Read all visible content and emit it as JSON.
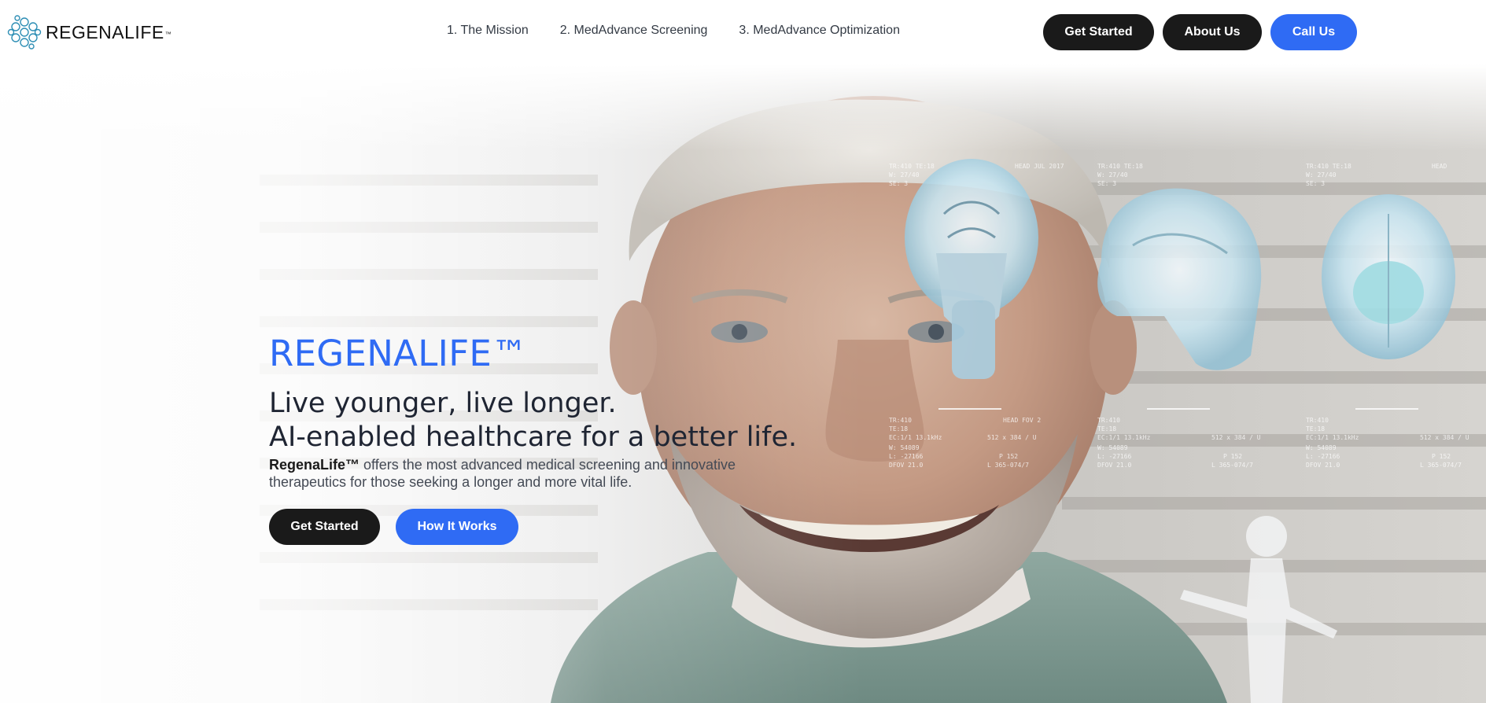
{
  "brand": {
    "name": "REGENALIFE",
    "tm": "™",
    "logo_icon": "molecule-cluster-icon"
  },
  "nav": {
    "links": [
      "1. The Mission",
      "2. MedAdvance Screening",
      "3. MedAdvance Optimization"
    ]
  },
  "header_actions": {
    "get_started": "Get Started",
    "about_us": "About Us",
    "call_us": "Call Us"
  },
  "hero": {
    "brand_title": "REGENALIFE™",
    "headline_line1": "Live younger, live longer.",
    "headline_line2": "AI-enabled healthcare for a better life.",
    "desc_brand": "RegenaLife™",
    "desc_rest": " offers the most advanced medical screening and innovative therapeutics for those seeking a longer and more vital life.",
    "get_started": "Get Started",
    "how_it_works": "How It Works"
  },
  "colors": {
    "accent": "#2f6bf4",
    "dark_button": "#1a1a1a",
    "text": "#1f2533"
  }
}
